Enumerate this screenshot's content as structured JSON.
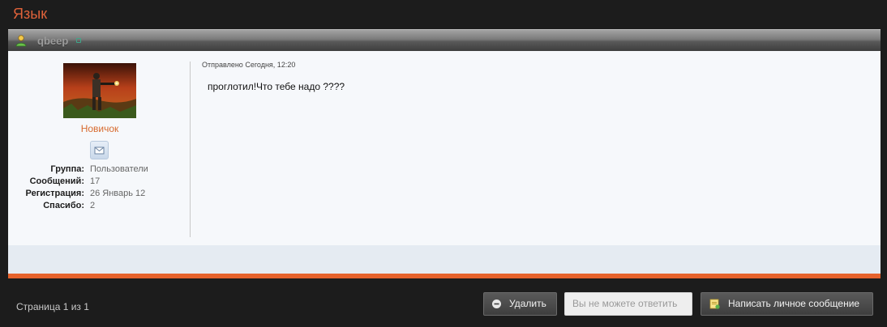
{
  "topic": {
    "title": "Язык"
  },
  "post": {
    "author_name": "qbeep",
    "rank": "Новичок",
    "posted_label": "Отправлено Сегодня, 12:20",
    "content": "проглотил!Что тебе надо ????",
    "author_info": [
      {
        "label": "Группа:",
        "value": "Пользователи"
      },
      {
        "label": "Сообщений:",
        "value": "17"
      },
      {
        "label": "Регистрация:",
        "value": "26 Январь 12"
      },
      {
        "label": "Спасибо:",
        "value": "2"
      }
    ]
  },
  "footer": {
    "pagination": "Страница 1 из 1",
    "delete_label": "Удалить",
    "cannot_reply_label": "Вы не можете ответить",
    "write_pm_label": "Написать личное сообщение"
  },
  "icons": {
    "user_status": "user-online-icon",
    "send_pm": "envelope-icon",
    "delete": "minus-circle-icon",
    "write_pm": "note-icon"
  },
  "colors": {
    "accent": "#e5622c",
    "rank": "#d86a2e",
    "page_bg": "#1c1c1c",
    "post_bg": "#f6f8fb"
  }
}
